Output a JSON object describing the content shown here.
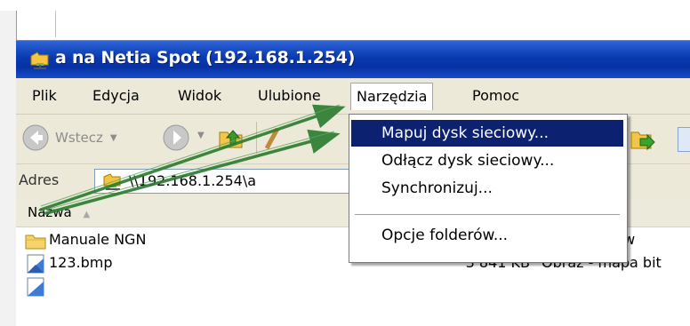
{
  "window": {
    "title": "a na Netia Spot (192.168.1.254)"
  },
  "menubar": {
    "items": [
      "Plik",
      "Edycja",
      "Widok",
      "Ulubione",
      "Narzędzia",
      "Pomoc"
    ]
  },
  "toolbar": {
    "back_label": "Wstecz"
  },
  "address": {
    "label": "Adres",
    "value": "\\\\192.168.1.254\\a"
  },
  "list": {
    "columns": [
      "Nazwa"
    ],
    "rows": [
      {
        "name": "Manuale NGN",
        "size": "",
        "type": "Folder plików",
        "icon": "folder-icon"
      },
      {
        "name": "123.bmp",
        "size": "3 841 KB",
        "type": "Obraz - mapa bit",
        "icon": "bitmap-file-icon"
      }
    ]
  },
  "dropdown": {
    "items": [
      "Mapuj dysk sieciowy...",
      "Odłącz dysk sieciowy...",
      "Synchronizuj...",
      "Opcje folderów..."
    ],
    "highlighted_index": 0
  },
  "colors": {
    "titlebar": "#0a3ab0",
    "menu_highlight": "#0c2170",
    "annotation_arrow": "#2e7d32"
  }
}
